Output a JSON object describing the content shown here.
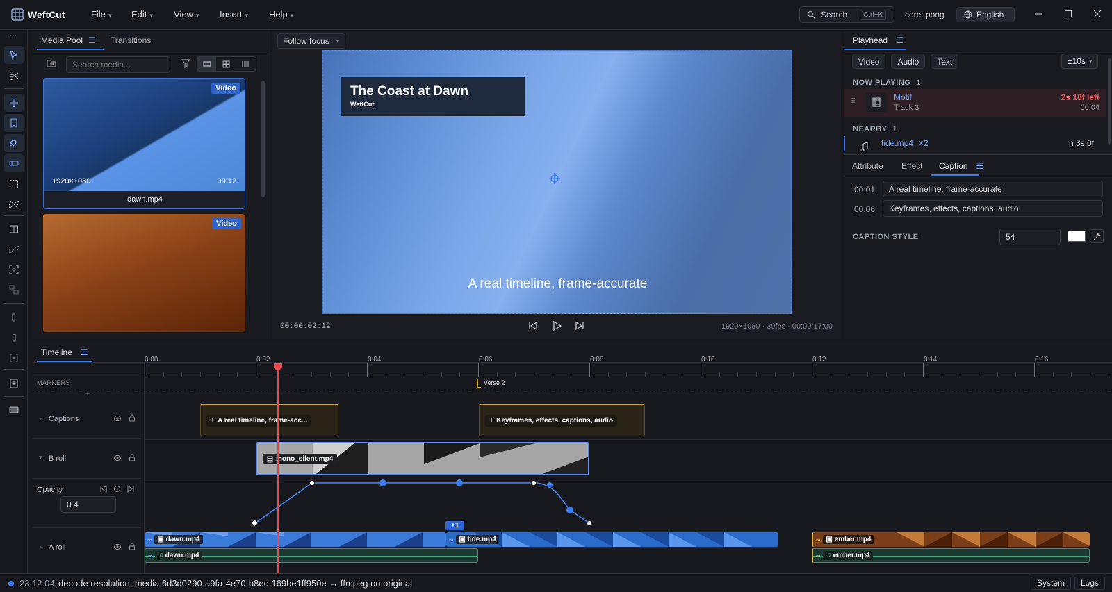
{
  "app": {
    "name": "WeftCut"
  },
  "menu": [
    {
      "label": "File"
    },
    {
      "label": "Edit"
    },
    {
      "label": "View"
    },
    {
      "label": "Insert"
    },
    {
      "label": "Help"
    }
  ],
  "titlebar": {
    "search_label": "Search",
    "search_shortcut": "Ctrl+K",
    "core_label": "core: pong",
    "language": "English"
  },
  "media_pool": {
    "tabs": [
      "Media Pool",
      "Transitions"
    ],
    "search_placeholder": "Search media...",
    "items": [
      {
        "badge": "Video",
        "resolution": "1920×1080",
        "duration": "00:12",
        "name": "dawn.mp4"
      },
      {
        "badge": "Video"
      }
    ]
  },
  "viewer": {
    "follow_label": "Follow focus",
    "title_card_title": "The Coast at Dawn",
    "title_card_sub": "WeftCut",
    "caption": "A real timeline, frame-accurate",
    "timecode": "00:00:02:12",
    "info": "1920×1080 · 30fps · 00:00:17:00"
  },
  "playhead_panel": {
    "tab": "Playhead",
    "filters": [
      "Video",
      "Audio",
      "Text"
    ],
    "range": "±10s",
    "now_playing_label": "NOW PLAYING",
    "now_playing_count": "1",
    "now_item": {
      "name": "Motif",
      "track": "Track 3",
      "left": "2s 18f left",
      "time": "00:04"
    },
    "nearby_label": "NEARBY",
    "nearby_count": "1",
    "nearby_item": {
      "name": "tide.mp4",
      "mult": "×2",
      "when": "in 3s 0f"
    }
  },
  "inspector": {
    "tabs": [
      "Attribute",
      "Effect",
      "Caption"
    ],
    "captions": [
      {
        "time": "00:01",
        "text": "A real timeline, frame-accurate"
      },
      {
        "time": "00:06",
        "text": "Keyframes, effects, captions, audio"
      }
    ],
    "style_label": "CAPTION STYLE",
    "font_size": "54"
  },
  "timeline": {
    "tab": "Timeline",
    "ticks": [
      "0:00",
      "0:02",
      "0:04",
      "0:06",
      "0:08",
      "0:10",
      "0:12",
      "0:14",
      "0:16"
    ],
    "markers_label": "MARKERS",
    "marker": "Verse 2",
    "tracks": {
      "captions": "Captions",
      "broll": "B roll",
      "opacity": "Opacity",
      "opacity_value": "0.4",
      "aroll": "A roll"
    },
    "clips": {
      "cap1": "A real timeline, frame-acc...",
      "cap2": "Keyframes, effects, captions, audio",
      "mono": "mono_silent.mp4",
      "dawn_v": "dawn.mp4",
      "dawn_a": "dawn.mp4",
      "tide": "tide.mp4",
      "plus": "+1",
      "ember_v": "ember.mp4",
      "ember_a": "ember.mp4"
    }
  },
  "statusbar": {
    "time": "23:12:04",
    "message": "decode resolution: media 6d3d0290-a9fa-4e70-b8ec-169be1ff950e → ffmpeg on original",
    "system": "System",
    "logs": "Logs"
  },
  "colors": {
    "accent": "#3d7bf0",
    "playhead": "#e5484d",
    "caption_clip": "#d4a84a",
    "broll_border": "#5b8cff"
  }
}
